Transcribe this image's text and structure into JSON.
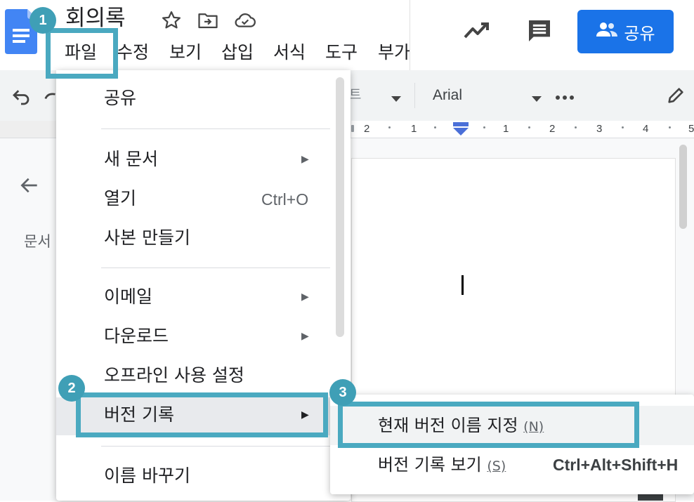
{
  "header": {
    "doc_title": "회의록",
    "share_label": "공유"
  },
  "menubar": [
    "파일",
    "수정",
    "보기",
    "삽입",
    "서식",
    "도구",
    "부가"
  ],
  "toolbar": {
    "style_fragment": "트",
    "font_name": "Arial"
  },
  "ruler": [
    "2",
    "1",
    "1",
    "2",
    "3",
    "4",
    "5"
  ],
  "outline": {
    "label": "문서"
  },
  "file_menu": {
    "items": {
      "share": "공유",
      "new_doc": "새 문서",
      "open": "열기",
      "open_shortcut": "Ctrl+O",
      "make_copy": "사본 만들기",
      "email": "이메일",
      "download": "다운로드",
      "offline": "오프라인 사용 설정",
      "version_history": "버전 기록",
      "rename": "이름 바꾸기"
    }
  },
  "version_submenu": {
    "name_current": "현재 버전 이름 지정",
    "name_current_mnemonic": "(N)",
    "see_history": "버전 기록 보기",
    "see_history_mnemonic": "(S)",
    "see_history_shortcut": "Ctrl+Alt+Shift+H"
  },
  "annotations": [
    "1",
    "2",
    "3"
  ],
  "colors": {
    "accent": "#1a73e8",
    "callout": "#4aa9c0",
    "badge": "#3f9fb6"
  }
}
